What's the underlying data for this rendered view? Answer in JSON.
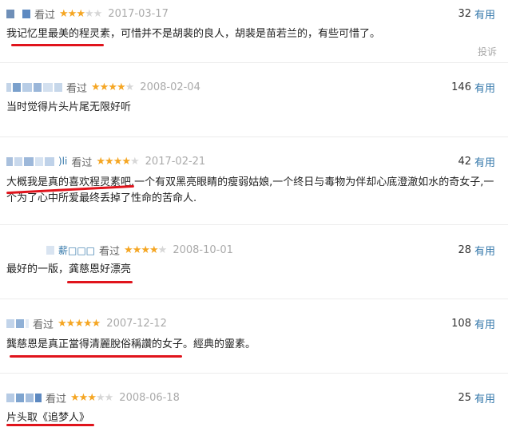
{
  "reviews": [
    {
      "status": "看过",
      "rating": 3,
      "date": "2017-03-17",
      "votes": "32",
      "useful_label": "有用",
      "user_suffix": "",
      "content": "我记忆里最美的程灵素，可惜并不是胡裴的良人，胡裴是苗若兰的，有些可惜了。"
    },
    {
      "status": "看过",
      "rating": 4,
      "date": "2008-02-04",
      "votes": "146",
      "useful_label": "有用",
      "user_suffix": "",
      "content": "当时觉得片头片尾无限好听"
    },
    {
      "status": "看过",
      "rating": 4,
      "date": "2017-02-21",
      "votes": "42",
      "useful_label": "有用",
      "user_suffix": ")li",
      "content": "大概我是真的喜欢程灵素吧.一个有双黑亮眼睛的瘦弱姑娘,一个终日与毒物为伴却心底澄澈如水的奇女子,一个为了心中所爱最终丢掉了性命的苦命人."
    },
    {
      "status": "看过",
      "rating": 4,
      "date": "2008-10-01",
      "votes": "28",
      "useful_label": "有用",
      "user_suffix": "薪□□□",
      "content": "最好的一版，龚慈恩好漂亮"
    },
    {
      "status": "看过",
      "rating": 5,
      "date": "2007-12-12",
      "votes": "108",
      "useful_label": "有用",
      "user_suffix": "",
      "content": "龔慈恩是真正當得清麗脫俗稱讚的女子。經典的靈素。"
    },
    {
      "status": "看过",
      "rating": 3,
      "date": "2008-06-18",
      "votes": "25",
      "useful_label": "有用",
      "user_suffix": "",
      "content": "片头取《追梦人》"
    }
  ],
  "report_label": "投诉",
  "colors": {
    "star_on": "#f5a623",
    "star_off": "#d7d7d7",
    "link": "#3377aa",
    "highlight_underline": "#e0141c"
  }
}
